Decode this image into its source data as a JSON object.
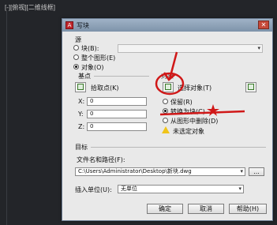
{
  "app": {
    "viewport_label": "[-][俯视][二维线框]"
  },
  "dialog": {
    "title": "写块",
    "close_symbol": "✕",
    "source": {
      "label": "源",
      "block_option": "块(B):",
      "whole_drawing_option": "整个图形(E)",
      "objects_option": "对象(O)",
      "selected": "objects"
    },
    "base_point": {
      "label": "基点",
      "pick_label": "拾取点(K)",
      "x_label": "X:",
      "y_label": "Y:",
      "z_label": "Z:",
      "x_value": "0",
      "y_value": "0",
      "z_value": "0"
    },
    "objects": {
      "label": "对象",
      "select_label": "选择对象(T)",
      "retain_option": "保留(R)",
      "convert_option": "转换为块(C)",
      "delete_option": "从图形中删除(D)",
      "selected": "convert",
      "status_text": "未选定对象"
    },
    "destination": {
      "label": "目标",
      "path_label": "文件名和路径(F):",
      "path_value": "C:\\Users\\Administrator\\Desktop\\新块.dwg",
      "browse_label": "...",
      "units_label": "插入单位(U):",
      "units_value": "无单位"
    },
    "buttons": {
      "ok": "确定",
      "cancel": "取消",
      "help": "帮助(H)"
    }
  },
  "colors": {
    "annotation_red": "#d01818",
    "dialog_bg": "#e9e9e9",
    "titlebar": "#8fa3b8",
    "warning": "#f0c419"
  }
}
